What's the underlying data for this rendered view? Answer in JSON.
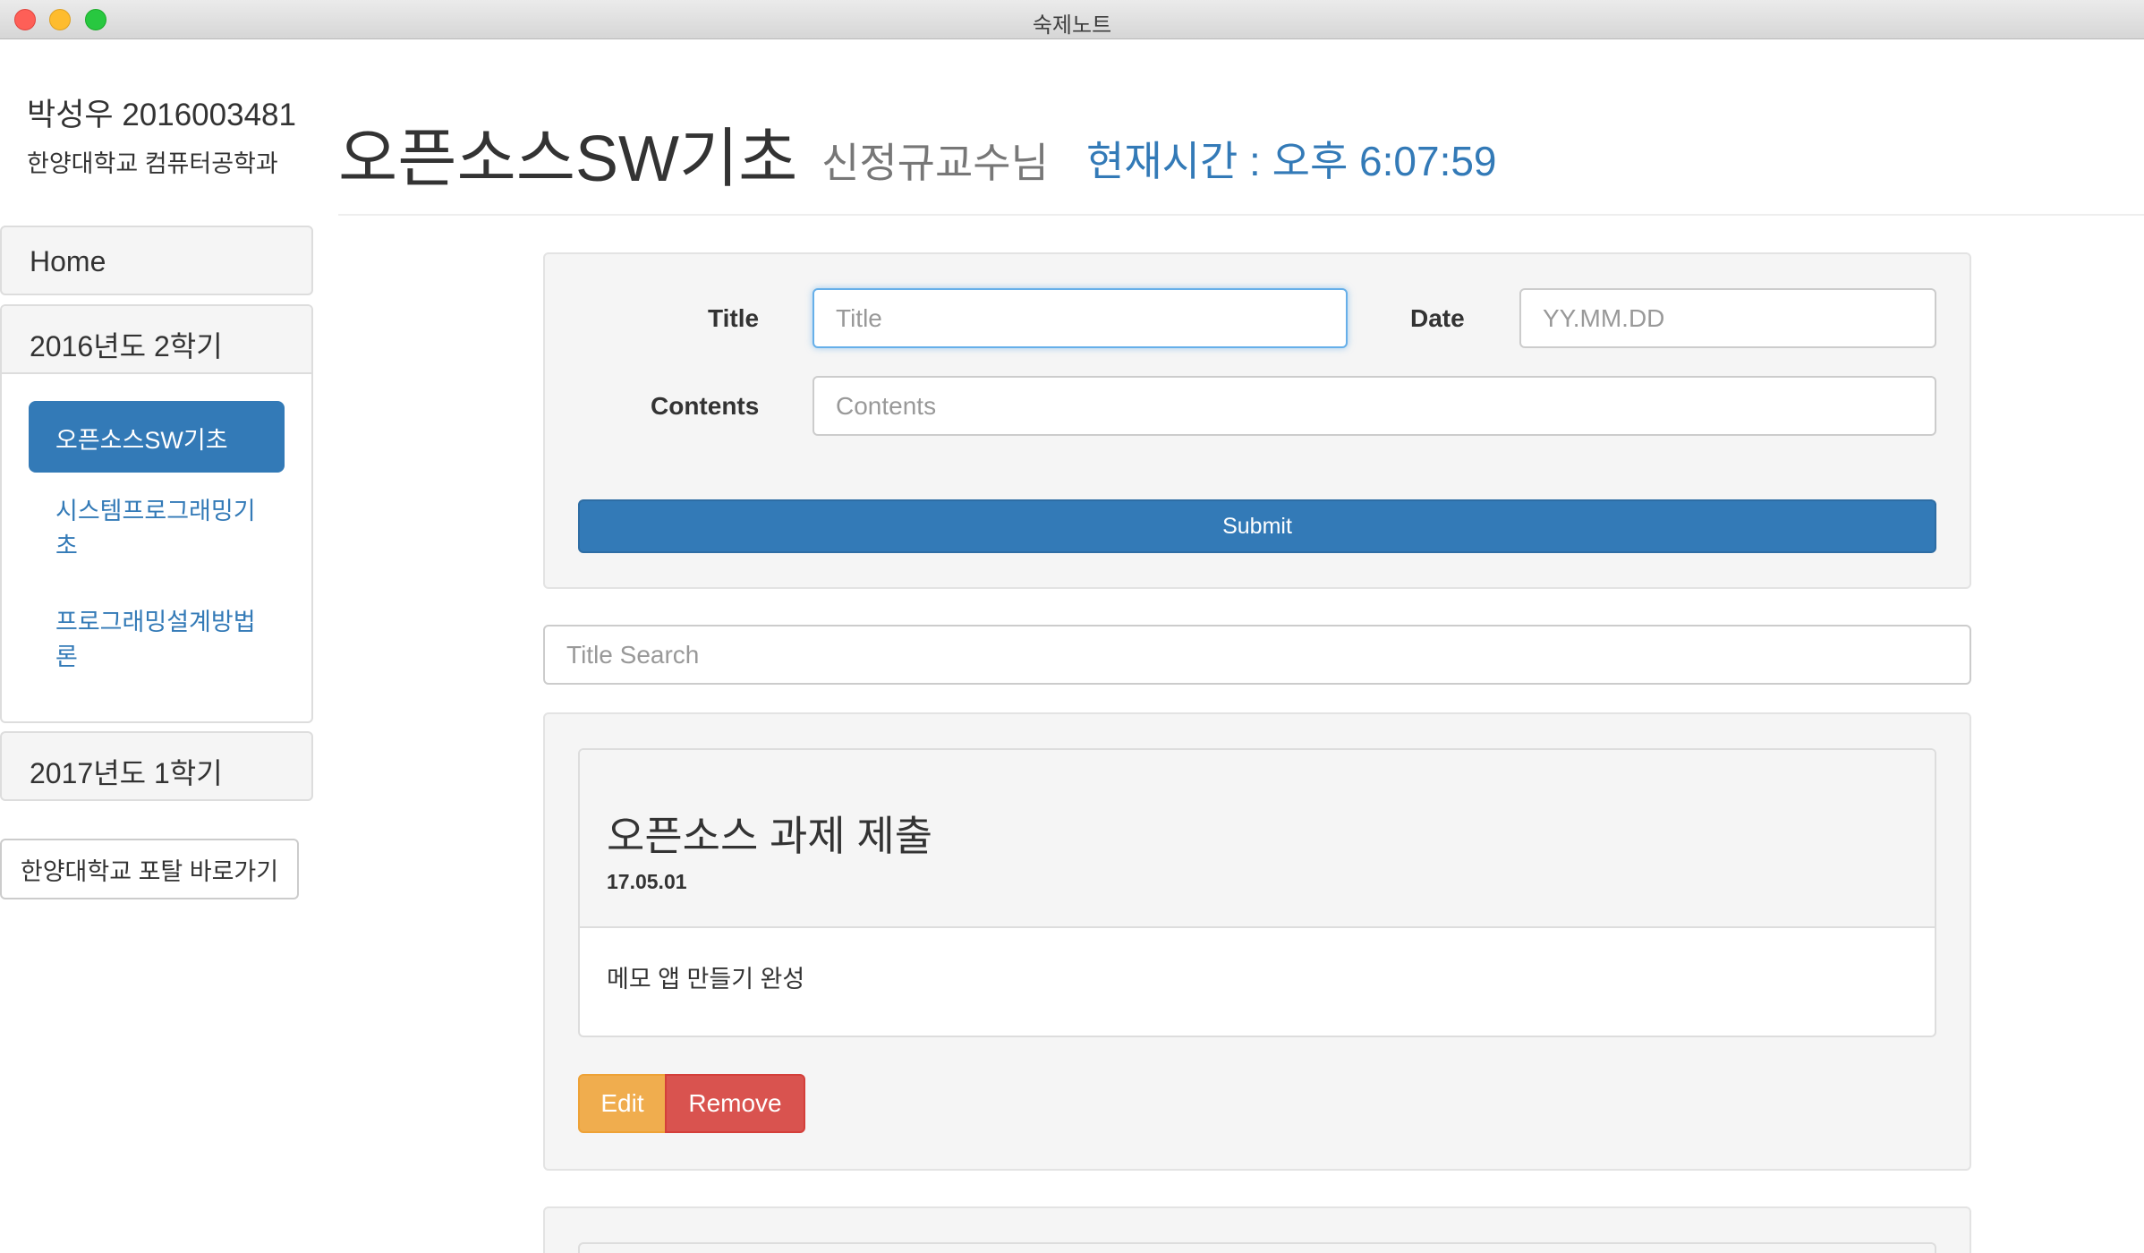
{
  "window": {
    "title": "숙제노트"
  },
  "sidebar": {
    "user_name": "박성우 2016003481",
    "department": "한양대학교 컴퓨터공학과",
    "home_label": "Home",
    "semesters": [
      {
        "label": "2016년도 2학기",
        "courses": [
          {
            "label": "오픈소스SW기초",
            "active": true
          },
          {
            "label": "시스템프로그래밍기초",
            "active": false
          },
          {
            "label": "프로그래밍설계방법론",
            "active": false
          }
        ]
      },
      {
        "label": "2017년도 1학기"
      }
    ],
    "portal_button": "한양대학교 포탈 바로가기"
  },
  "header": {
    "course_title": "오픈소스SW기초",
    "professor": "신정규교수님",
    "clock": "현재시간 : 오후 6:07:59"
  },
  "form": {
    "title_label": "Title",
    "title_placeholder": "Title",
    "title_value": "",
    "date_label": "Date",
    "date_placeholder": "YY.MM.DD",
    "date_value": "",
    "contents_label": "Contents",
    "contents_placeholder": "Contents",
    "contents_value": "",
    "submit_label": "Submit"
  },
  "search": {
    "placeholder": "Title Search",
    "value": ""
  },
  "memos": [
    {
      "title": "오픈소스 과제 제출",
      "date": "17.05.01",
      "body": "메모 앱 만들기 완성",
      "edit_label": "Edit",
      "remove_label": "Remove"
    }
  ],
  "colors": {
    "primary": "#337ab7",
    "warning": "#f0ad4e",
    "danger": "#d9534f",
    "muted": "#777777",
    "well": "#f5f5f5"
  }
}
